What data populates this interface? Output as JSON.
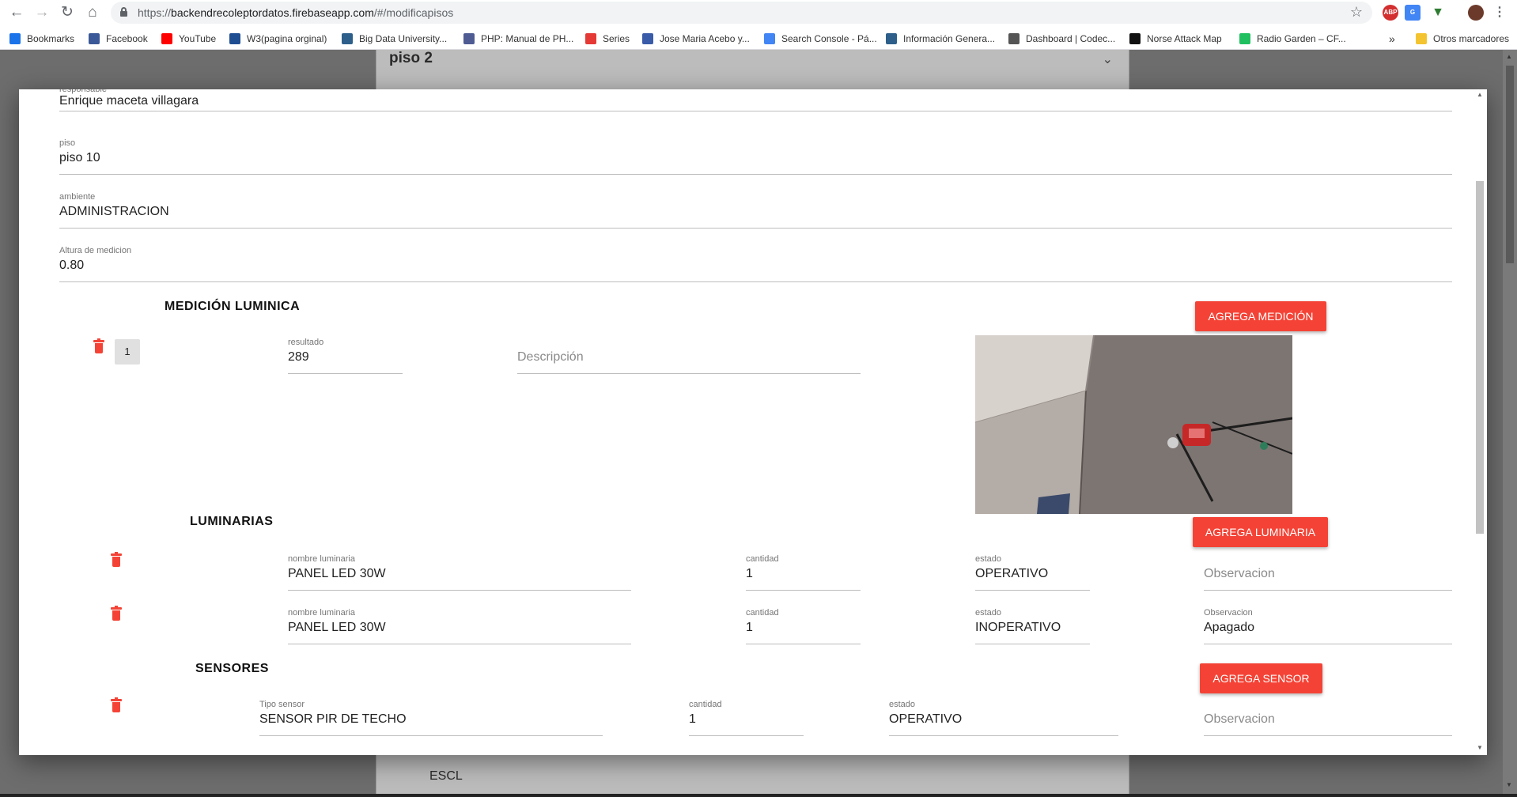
{
  "browser": {
    "url_prefix": "https://",
    "url_host": "backendrecoleptordatos.firebaseapp.com",
    "url_path": "/#/modificapisos",
    "bookmarks": [
      {
        "label": "Bookmarks",
        "icon": "star-icon",
        "color": "#1a73e8"
      },
      {
        "label": "Facebook",
        "icon": "facebook-icon",
        "color": "#3b5998"
      },
      {
        "label": "YouTube",
        "icon": "youtube-icon",
        "color": "#ff0000"
      },
      {
        "label": "W3(pagina orginal)",
        "icon": "w3-icon",
        "color": "#1f4d92"
      },
      {
        "label": "Big Data University...",
        "icon": "bdu-icon",
        "color": "#2d5f8a"
      },
      {
        "label": "PHP: Manual de PH...",
        "icon": "php-icon",
        "color": "#4f5b93"
      },
      {
        "label": "Series",
        "icon": "play-icon",
        "color": "#e53935"
      },
      {
        "label": "Jose Maria Acebo y...",
        "icon": "doc-icon",
        "color": "#3a5ca8"
      },
      {
        "label": "Search Console - Pá...",
        "icon": "search-console-icon",
        "color": "#4285f4"
      },
      {
        "label": "Información Genera...",
        "icon": "info-icon",
        "color": "#2d5f8a"
      },
      {
        "label": "Dashboard | Codec...",
        "icon": "codec-icon",
        "color": "#555555"
      },
      {
        "label": "Norse Attack Map",
        "icon": "norse-icon",
        "color": "#111111"
      },
      {
        "label": "Radio Garden – CF...",
        "icon": "radio-garden-icon",
        "color": "#20c060"
      }
    ],
    "more_bookmarks": "»",
    "other_bookmarks": "Otros marcadores"
  },
  "background": {
    "section_title": "piso 2",
    "partial_text": "ESCL"
  },
  "form": {
    "responsable": {
      "label": "responsable",
      "value": "Enrique maceta villagara"
    },
    "piso": {
      "label": "piso",
      "value": "piso 10"
    },
    "ambiente": {
      "label": "ambiente",
      "value": "ADMINISTRACION"
    },
    "altura": {
      "label": "Altura de medicion",
      "value": "0.80"
    }
  },
  "medicion": {
    "title": "MEDICIÓN LUMINICA",
    "add_button": "AGREGA MEDICIÓN",
    "items": [
      {
        "index": "1",
        "resultado_label": "resultado",
        "resultado": "289",
        "descripcion_placeholder": "Descripción"
      }
    ]
  },
  "luminarias": {
    "title": "LUMINARIAS",
    "add_button": "AGREGA LUMINARIA",
    "items": [
      {
        "nombre_label": "nombre luminaria",
        "nombre": "PANEL LED 30W",
        "cantidad_label": "cantidad",
        "cantidad": "1",
        "estado_label": "estado",
        "estado": "OPERATIVO",
        "observacion_label": "",
        "observacion": "",
        "observacion_placeholder": "Observacion"
      },
      {
        "nombre_label": "nombre luminaria",
        "nombre": "PANEL LED 30W",
        "cantidad_label": "cantidad",
        "cantidad": "1",
        "estado_label": "estado",
        "estado": "INOPERATIVO",
        "observacion_label": "Observacion",
        "observacion": "Apagado",
        "observacion_placeholder": ""
      }
    ]
  },
  "sensores": {
    "title": "SENSORES",
    "add_button": "AGREGA SENSOR",
    "items": [
      {
        "tipo_label": "Tipo sensor",
        "tipo": "SENSOR PIR DE TECHO",
        "cantidad_label": "cantidad",
        "cantidad": "1",
        "estado_label": "estado",
        "estado": "OPERATIVO",
        "observacion_placeholder": "Observacion"
      }
    ]
  },
  "colors": {
    "accent": "#f44336",
    "overlay": "#6d6d6d"
  }
}
